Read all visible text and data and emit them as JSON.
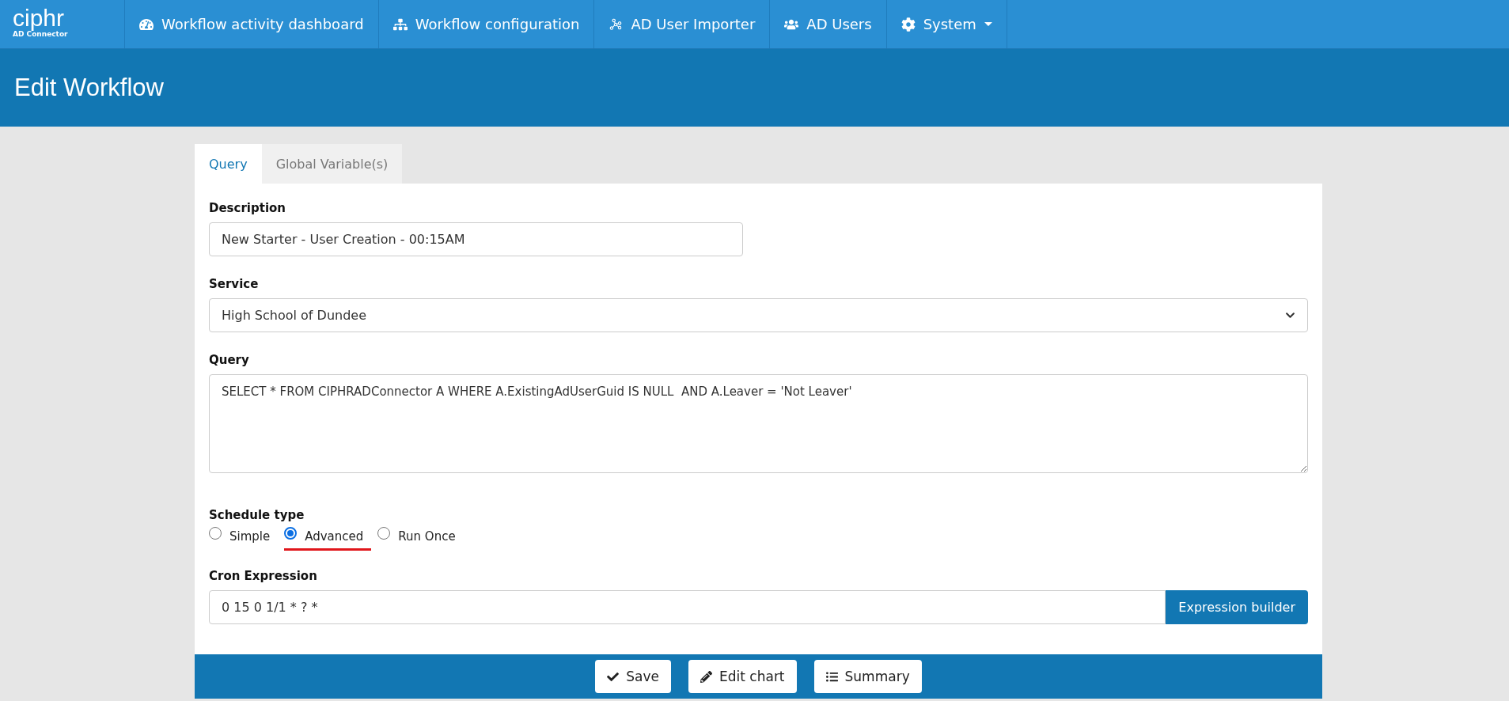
{
  "navbar": {
    "logo": {
      "name": "ciphr",
      "subtitle": "AD Connector"
    },
    "items": [
      {
        "label": "Workflow activity dashboard",
        "dropdown": false
      },
      {
        "label": "Workflow configuration",
        "dropdown": false
      },
      {
        "label": "AD User Importer",
        "dropdown": false
      },
      {
        "label": "AD Users",
        "dropdown": false
      },
      {
        "label": "System",
        "dropdown": true
      }
    ]
  },
  "header": {
    "title": "Edit Workflow"
  },
  "tabs": [
    {
      "label": "Query",
      "selected": true
    },
    {
      "label": "Global Variable(s)",
      "selected": false
    }
  ],
  "form": {
    "description": {
      "label": "Description",
      "value": "New Starter - User Creation - 00:15AM"
    },
    "service": {
      "label": "Service",
      "value": "High School of Dundee"
    },
    "query": {
      "label": "Query",
      "value": "SELECT * FROM CIPHRADConnector A WHERE A.ExistingAdUserGuid IS NULL  AND A.Leaver = 'Not Leaver'"
    },
    "schedule_type": {
      "label": "Schedule type",
      "options": [
        {
          "label": "Simple",
          "selected": false,
          "underlined": false
        },
        {
          "label": "Advanced",
          "selected": true,
          "underlined": true
        },
        {
          "label": "Run Once",
          "selected": false,
          "underlined": false
        }
      ]
    },
    "cron": {
      "label": "Cron Expression",
      "value": "0 15 0 1/1 * ? *",
      "button": "Expression builder"
    }
  },
  "footer_buttons": [
    {
      "label": "Save"
    },
    {
      "label": "Edit chart"
    },
    {
      "label": "Summary"
    }
  ]
}
